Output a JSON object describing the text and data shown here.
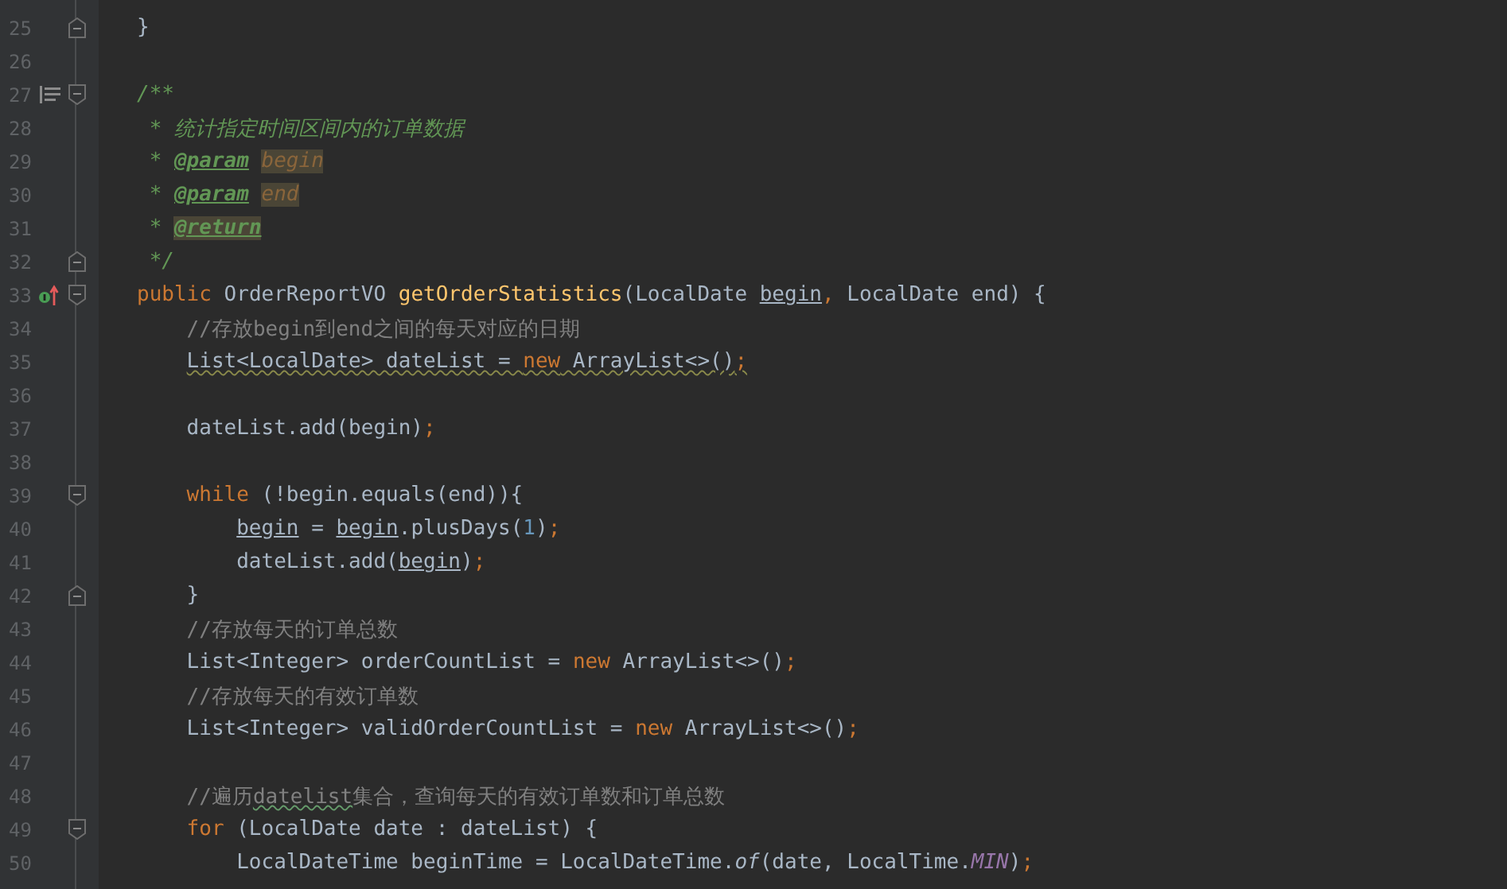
{
  "editor": {
    "lines": [
      {
        "number": "25",
        "fold_end": true,
        "tokens": [
          {
            "text": "}",
            "kind": "plain"
          }
        ]
      },
      {
        "number": "26"
      },
      {
        "number": "27",
        "fold_start": true,
        "doc_toggle": true,
        "tokens": [
          {
            "text": "/**",
            "kind": "doc"
          }
        ]
      },
      {
        "number": "28",
        "tokens": [
          {
            "text": " * 统计指定时间区间内的订单数据",
            "kind": "doc"
          }
        ]
      },
      {
        "number": "29",
        "tokens": [
          {
            "text": " * ",
            "kind": "doc"
          },
          {
            "text": "@param",
            "kind": "tag",
            "highlighted": false
          },
          {
            "text": "begin",
            "kind": "docparam",
            "highlighted": true
          }
        ]
      },
      {
        "number": "30",
        "tokens": [
          {
            "text": " * ",
            "kind": "doc"
          },
          {
            "text": "@param",
            "kind": "tag",
            "highlighted": false
          },
          {
            "text": "end",
            "kind": "docparam",
            "highlighted": true
          }
        ]
      },
      {
        "number": "31",
        "tokens": [
          {
            "text": " * ",
            "kind": "doc"
          },
          {
            "text": "@return",
            "kind": "tag",
            "highlighted": true
          }
        ]
      },
      {
        "number": "32",
        "fold_end": true,
        "tokens": [
          {
            "text": " */",
            "kind": "doc"
          }
        ]
      },
      {
        "number": "33",
        "fold_start": true,
        "implements_marker": true,
        "tokens": [
          {
            "text": "public",
            "kind": "keyword"
          },
          {
            "text": " OrderReportVO ",
            "kind": "plain"
          },
          {
            "text": "getOrderStatistics",
            "kind": "method"
          },
          {
            "text": "(LocalDate ",
            "kind": "plain"
          },
          {
            "text": "begin",
            "kind": "plain",
            "usage": true
          },
          {
            "text": ",",
            "kind": "keyword"
          },
          {
            "text": " LocalDate end) {",
            "kind": "plain"
          }
        ],
        "children": [
          {
            "number": "34",
            "tokens": [
              {
                "text": "//存放begin到end之间的每天对应的日期",
                "kind": "comment"
              }
            ]
          },
          {
            "number": "35",
            "tokens": [
              {
                "text": "List<LocalDate> dateList = ",
                "kind": "plain",
                "warning": true
              },
              {
                "text": "new",
                "kind": "keyword",
                "warning": true
              },
              {
                "text": " ArrayList<>()",
                "kind": "plain",
                "warning": true
              },
              {
                "text": ";",
                "kind": "keyword",
                "warning": true
              }
            ]
          },
          {
            "number": "36"
          },
          {
            "number": "37",
            "tokens": [
              {
                "text": "dateList.add(begin)",
                "kind": "plain"
              },
              {
                "text": ";",
                "kind": "keyword"
              }
            ]
          },
          {
            "number": "38"
          },
          {
            "number": "39",
            "fold_start": true,
            "tokens": [
              {
                "text": "while",
                "kind": "keyword"
              },
              {
                "text": " (!begin.equals(end)){",
                "kind": "plain"
              }
            ],
            "children": [
              {
                "number": "40",
                "tokens": [
                  {
                    "text": "begin",
                    "kind": "plain",
                    "usage": true
                  },
                  {
                    "text": " = ",
                    "kind": "plain"
                  },
                  {
                    "text": "begin",
                    "kind": "plain",
                    "usage": true
                  },
                  {
                    "text": ".plusDays(",
                    "kind": "plain"
                  },
                  {
                    "text": "1",
                    "kind": "number"
                  },
                  {
                    "text": ")",
                    "kind": "plain"
                  },
                  {
                    "text": ";",
                    "kind": "keyword"
                  }
                ]
              },
              {
                "number": "41",
                "tokens": [
                  {
                    "text": "dateList.add(",
                    "kind": "plain"
                  },
                  {
                    "text": "begin",
                    "kind": "plain",
                    "usage": true
                  },
                  {
                    "text": ")",
                    "kind": "plain"
                  },
                  {
                    "text": ";",
                    "kind": "keyword"
                  }
                ]
              }
            ]
          },
          {
            "number": "42",
            "fold_end": true,
            "tokens": [
              {
                "text": "}",
                "kind": "plain"
              }
            ]
          },
          {
            "number": "43",
            "tokens": [
              {
                "text": "//存放每天的订单总数",
                "kind": "comment"
              }
            ]
          },
          {
            "number": "44",
            "tokens": [
              {
                "text": "List<Integer> orderCountList = ",
                "kind": "plain"
              },
              {
                "text": "new",
                "kind": "keyword"
              },
              {
                "text": " ArrayList<>()",
                "kind": "plain"
              },
              {
                "text": ";",
                "kind": "keyword"
              }
            ]
          },
          {
            "number": "45",
            "tokens": [
              {
                "text": "//存放每天的有效订单数",
                "kind": "comment"
              }
            ]
          },
          {
            "number": "46",
            "tokens": [
              {
                "text": "List<Integer> validOrderCountList = ",
                "kind": "plain"
              },
              {
                "text": "new",
                "kind": "keyword"
              },
              {
                "text": " ArrayList<>()",
                "kind": "plain"
              },
              {
                "text": ";",
                "kind": "keyword"
              }
            ]
          },
          {
            "number": "47"
          },
          {
            "number": "48",
            "tokens": [
              {
                "text": "//遍历",
                "kind": "comment"
              },
              {
                "text": "datelist",
                "kind": "comment",
                "typo": true
              },
              {
                "text": "集合，查询每天的有效订单数和订单总数",
                "kind": "comment"
              }
            ]
          },
          {
            "number": "49",
            "fold_start": true,
            "tokens": [
              {
                "text": "for",
                "kind": "keyword"
              },
              {
                "text": " (LocalDate date : dateList) {",
                "kind": "plain"
              }
            ],
            "children": [
              {
                "number": "50",
                "tokens": [
                  {
                    "text": "LocalDateTime beginTime = LocalDateTime.",
                    "kind": "plain"
                  },
                  {
                    "text": "of",
                    "kind": "static-method"
                  },
                  {
                    "text": "(date, LocalTime.",
                    "kind": "plain"
                  },
                  {
                    "text": "MIN",
                    "kind": "static-field"
                  },
                  {
                    "text": ")",
                    "kind": "plain"
                  },
                  {
                    "text": ";",
                    "kind": "keyword"
                  }
                ]
              }
            ]
          }
        ]
      }
    ]
  }
}
